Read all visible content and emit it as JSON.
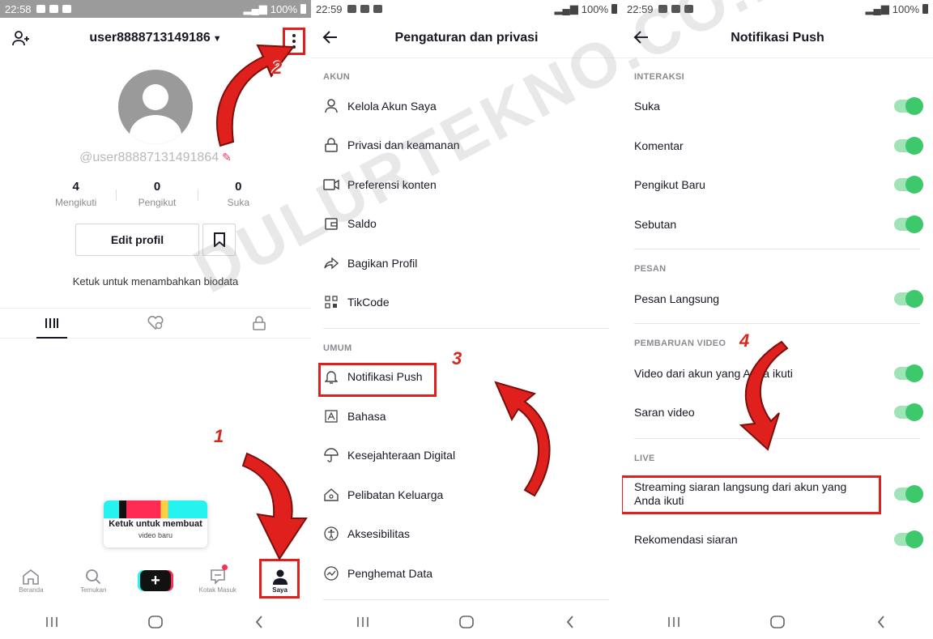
{
  "watermark": "DULURTEKNO.CO.ID",
  "steps": [
    "1",
    "2",
    "3",
    "4"
  ],
  "accent_red": "#e0201c",
  "toggle_color": "#3cc86b",
  "panel1": {
    "status": {
      "time": "22:58",
      "battery": "100%"
    },
    "username": "user8888713149186",
    "handle": "@user88887131491864",
    "stats": [
      {
        "value": "4",
        "label": "Mengikuti"
      },
      {
        "value": "0",
        "label": "Pengikut"
      },
      {
        "value": "0",
        "label": "Suka"
      }
    ],
    "edit_profile": "Edit profil",
    "bio_prompt": "Ketuk untuk menambahkan biodata",
    "tooltip": {
      "line1": "Ketuk untuk membuat",
      "line2": "video baru"
    },
    "bottom_nav": {
      "home": "Beranda",
      "discover": "Temukan",
      "create": "+",
      "inbox": "Kotak Masuk",
      "profile": "Saya"
    }
  },
  "panel2": {
    "status": {
      "time": "22:59",
      "battery": "100%"
    },
    "title": "Pengaturan dan privasi",
    "section_account": "AKUN",
    "account_items": [
      {
        "icon": "person-icon",
        "label": "Kelola Akun Saya"
      },
      {
        "icon": "lock-icon",
        "label": "Privasi dan keamanan"
      },
      {
        "icon": "video-icon",
        "label": "Preferensi konten"
      },
      {
        "icon": "wallet-icon",
        "label": "Saldo"
      },
      {
        "icon": "share-icon",
        "label": "Bagikan Profil"
      },
      {
        "icon": "qr-icon",
        "label": "TikCode"
      }
    ],
    "section_general": "UMUM",
    "general_items": [
      {
        "icon": "bell-icon",
        "label": "Notifikasi Push"
      },
      {
        "icon": "language-icon",
        "label": "Bahasa"
      },
      {
        "icon": "umbrella-icon",
        "label": "Kesejahteraan Digital"
      },
      {
        "icon": "home-shield-icon",
        "label": "Pelibatan Keluarga"
      },
      {
        "icon": "accessibility-icon",
        "label": "Aksesibilitas"
      },
      {
        "icon": "data-saver-icon",
        "label": "Penghemat Data"
      }
    ]
  },
  "panel3": {
    "status": {
      "time": "22:59",
      "battery": "100%"
    },
    "title": "Notifikasi Push",
    "section_interactions": "INTERAKSI",
    "interactions": [
      {
        "label": "Suka",
        "on": true
      },
      {
        "label": "Komentar",
        "on": true
      },
      {
        "label": "Pengikut Baru",
        "on": true
      },
      {
        "label": "Sebutan",
        "on": true
      }
    ],
    "section_messages": "PESAN",
    "messages": [
      {
        "label": "Pesan Langsung",
        "on": true
      }
    ],
    "section_video": "PEMBARUAN VIDEO",
    "video_updates": [
      {
        "label": "Video dari akun yang Anda ikuti",
        "on": true
      },
      {
        "label": "Saran video",
        "on": true
      }
    ],
    "section_live": "LIVE",
    "live": [
      {
        "label": "Streaming siaran langsung dari akun yang Anda ikuti",
        "on": true
      },
      {
        "label": "Rekomendasi siaran",
        "on": true
      }
    ]
  }
}
